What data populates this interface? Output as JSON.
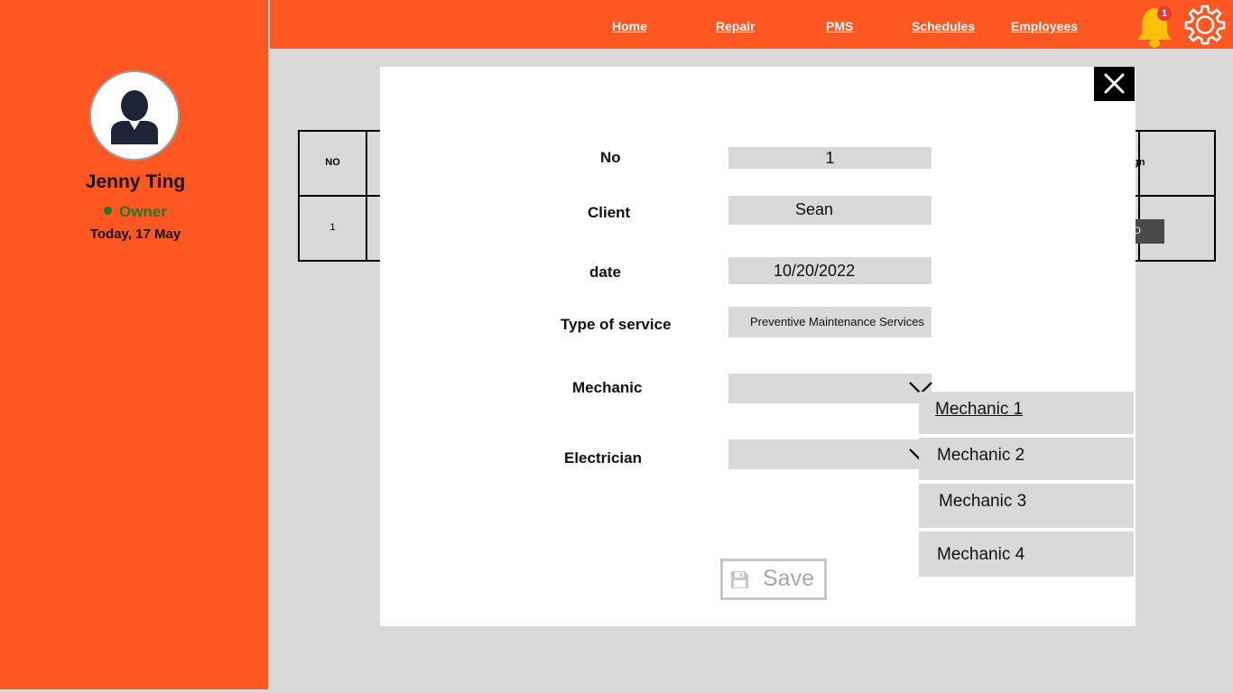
{
  "colors": {
    "accent": "#ff5722",
    "status_green": "#1b7a2e",
    "badge_red": "#e53935"
  },
  "sidebar": {
    "avatar_icon": "user-avatar-icon",
    "user_name": "Jenny Ting",
    "role": "Owner",
    "date": "Today, 17 May"
  },
  "nav": {
    "items": [
      {
        "label": "Home"
      },
      {
        "label": "Repair"
      },
      {
        "label": "PMS"
      },
      {
        "label": "Schedules"
      },
      {
        "label": "Employees"
      }
    ],
    "notification_count": "1",
    "bell_icon": "bell-icon",
    "settings_icon": "gear-icon"
  },
  "background_table": {
    "header_no": "NO",
    "header_assign_partial": "ign",
    "row_no": "1",
    "add_button_partial": "DD"
  },
  "modal": {
    "close_icon": "close-icon",
    "fields": {
      "no": {
        "label": "No",
        "value": "1"
      },
      "client": {
        "label": "Client",
        "value": "Sean"
      },
      "date": {
        "label": "date",
        "value": "10/20/2022"
      },
      "service": {
        "label": "Type of service",
        "value": "Preventive Maintenance Services"
      },
      "mechanic": {
        "label": "Mechanic",
        "value": ""
      },
      "electrician": {
        "label": "Electrician",
        "value": ""
      }
    },
    "mechanic_options": [
      "Mechanic 1",
      "Mechanic 2",
      "Mechanic 3",
      "Mechanic 4"
    ],
    "save_label": "Save",
    "save_icon": "floppy-disk-icon"
  }
}
